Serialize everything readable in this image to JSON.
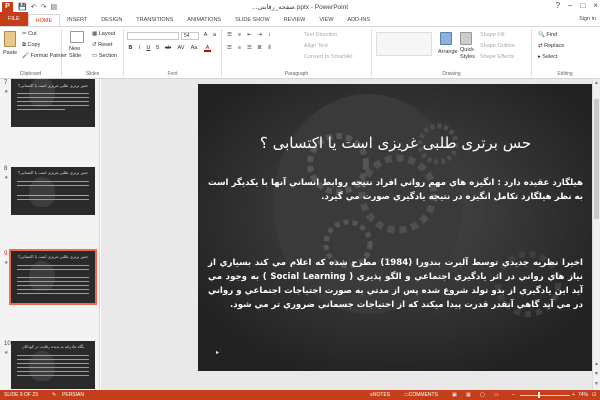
{
  "titlebar": {
    "title": "...صفحه_رقابتی.pptx - PowerPoint",
    "app_letter": "P",
    "qat": [
      "💾",
      "↶",
      "↷",
      "▤"
    ],
    "controls": [
      "?",
      "–",
      "□",
      "×"
    ]
  },
  "tabs": {
    "items": [
      "FILE",
      "HOME",
      "INSERT",
      "DESIGN",
      "TRANSITIONS",
      "ANIMATIONS",
      "SLIDE SHOW",
      "REVIEW",
      "VIEW",
      "ADD-INS"
    ],
    "active": "HOME",
    "signin": "Sign in"
  },
  "ribbon": {
    "clipboard": {
      "paste": "Paste",
      "cut": "Cut",
      "copy": "Copy",
      "format_painter": "Format Painter",
      "label": "Clipboard"
    },
    "slides": {
      "new_slide_line1": "New",
      "new_slide_line2": "Slide",
      "layout": "Layout",
      "reset": "Reset",
      "section": "Section",
      "label": "Slides"
    },
    "font": {
      "font_name": "",
      "font_size": "54",
      "label": "Font",
      "buttons": [
        "B",
        "I",
        "U",
        "S",
        "ab",
        "AV",
        "Aa",
        "A"
      ]
    },
    "paragraph": {
      "text_direction": "Text Direction",
      "align_text": "Align Text",
      "convert_smartart": "Convert to SmartArt",
      "label": "Paragraph"
    },
    "drawing": {
      "arrange": "Arrange",
      "quick_styles_1": "Quick",
      "quick_styles_2": "Styles",
      "shape_fill": "Shape Fill",
      "shape_outline": "Shape Outline",
      "shape_effects": "Shape Effects",
      "label": "Drawing"
    },
    "editing": {
      "find": "Find",
      "replace": "Replace",
      "select": "Select",
      "label": "Editing"
    }
  },
  "thumbnails": [
    {
      "number": "7",
      "title": "حس برتری طلبی غریزی است یا اکتسابی؟",
      "active": false
    },
    {
      "number": "8",
      "title": "حس برتری طلبی غریزی است یا اکتسابی؟",
      "active": false
    },
    {
      "number": "9",
      "title": "حس برتری طلبی غریزی است یا اکتسابی؟",
      "active": true
    },
    {
      "number": "10",
      "title": "نگاه مادرانه به پدیده رقابت در کودکان",
      "active": false
    }
  ],
  "slide": {
    "title": "حس برتری طلبی غریزی است یا اکتسابی ؟",
    "paragraph1": "هیلگارد عقیده دارد : انگیزه هاي مهم رواني افراد نتیجه روابط انساني آنها با یکدیگر است به نظر هیلگارد تکامل انگیزه در نتیجه یادگیري صورت مي گیرد.",
    "paragraph2": "اخیرا نظریه جدیدي توسط آلبرت بندورا (1984) مطرح شده که اعلام مي کند بسیاري از نیاز هاي رواني در اثر یادگیري اجتماعي و الگو پذیري ( Social Learning ) به وجود مي آید این یادگیري از بدو تولد شروع شده پس از مدتي به صورت احتیاجات اجتماعي و رواني در مي آید گاهي آنقدر قدرت پیدا میکند که از احتیاجات جسماني ضروري تر مي شود.",
    "bullet": "▸"
  },
  "statusbar": {
    "slide_info": "SLIDE 9 OF 23",
    "language": "PERSIAN",
    "notes": "NOTES",
    "comments": "COMMENTS",
    "zoom": "74%"
  },
  "colors": {
    "accent": "#c43e1c",
    "slide_bg": "#2c2c2c"
  }
}
